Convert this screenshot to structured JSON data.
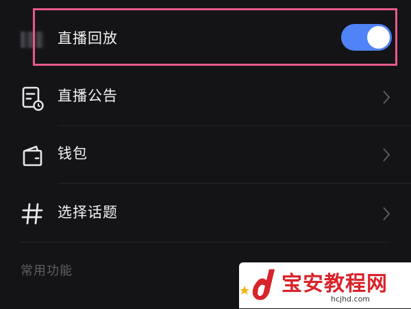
{
  "settings": {
    "replay": {
      "label": "直播回放",
      "enabled": true
    },
    "items": [
      {
        "label": "直播公告",
        "icon": "announcement-icon"
      },
      {
        "label": "钱包",
        "icon": "wallet-icon"
      },
      {
        "label": "选择话题",
        "icon": "hashtag-icon"
      }
    ]
  },
  "section": {
    "title": "常用功能"
  },
  "watermark": {
    "name": "宝安教程网",
    "url": "hcjhd.com"
  },
  "colors": {
    "toggle_on": "#4f83f7",
    "highlight": "#ea5a8a",
    "watermark_red": "#d8232a"
  }
}
